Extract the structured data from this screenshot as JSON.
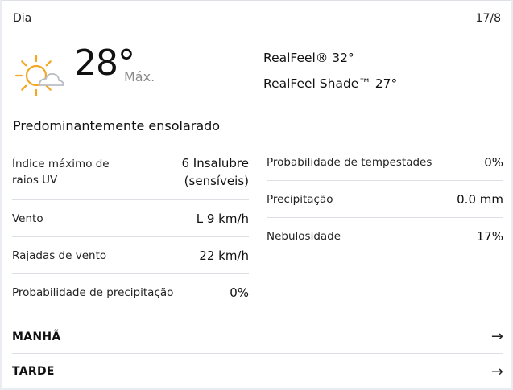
{
  "header": {
    "day_label": "Dia",
    "date": "17/8"
  },
  "current": {
    "icon": "partly-sunny-icon",
    "temperature": "28°",
    "max_label": "Máx.",
    "realfeel": "RealFeel® 32°",
    "realfeel_shade": "RealFeel Shade™ 27°",
    "phrase": "Predominantemente ensolarado"
  },
  "left_details": [
    {
      "label": "Índice máximo de raios UV",
      "value": "6 Insalubre (sensíveis)"
    },
    {
      "label": "Vento",
      "value": "L 9 km/h"
    },
    {
      "label": "Rajadas de vento",
      "value": "22 km/h"
    },
    {
      "label": "Probabilidade de precipitação",
      "value": "0%"
    }
  ],
  "right_details": [
    {
      "label": "Probabilidade de tempestades",
      "value": "0%"
    },
    {
      "label": "Precipitação",
      "value": "0.0 mm"
    },
    {
      "label": "Nebulosidade",
      "value": "17%"
    }
  ],
  "sections": [
    {
      "title": "MANHÃ",
      "arrow": "→"
    },
    {
      "title": "TARDE",
      "arrow": "→"
    }
  ],
  "colors": {
    "sun": "#f5a623",
    "cloud": "#c8ccd2",
    "divider": "#dcdfe3"
  }
}
